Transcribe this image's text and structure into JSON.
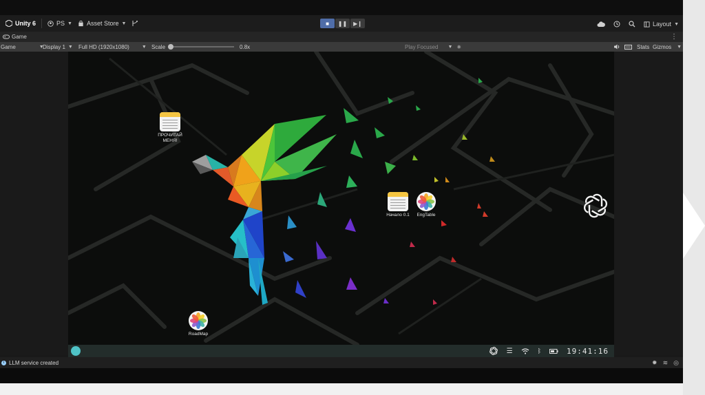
{
  "toolbar": {
    "app": "Unity 6",
    "account": "PS",
    "asset_store": "Asset Store",
    "layout": "Layout"
  },
  "tab": {
    "label": "Game"
  },
  "game_bar": {
    "mode": "Game",
    "display": "Display 1",
    "resolution": "Full HD (1920x1080)",
    "scale_label": "Scale",
    "scale_value": "0.8x",
    "play_focused": "Play Focused",
    "stats": "Stats",
    "gizmos": "Gizmos"
  },
  "desktop": {
    "icons": [
      {
        "label": "ПРОЧИТАЙ\nМЕНЯ!",
        "type": "note"
      },
      {
        "label": "Начало 0.1",
        "type": "note"
      },
      {
        "label": "EngTable",
        "type": "photos"
      },
      {
        "label": "RoadMap",
        "type": "photos"
      }
    ]
  },
  "taskbar": {
    "clock": "19:41:16"
  },
  "status": {
    "message": "LLM service created"
  },
  "colors": {
    "editor_bg": "#191919",
    "game_bg": "#0c0d0c",
    "taskbar": "#232d2b",
    "accent_play": "#4f6da8"
  }
}
